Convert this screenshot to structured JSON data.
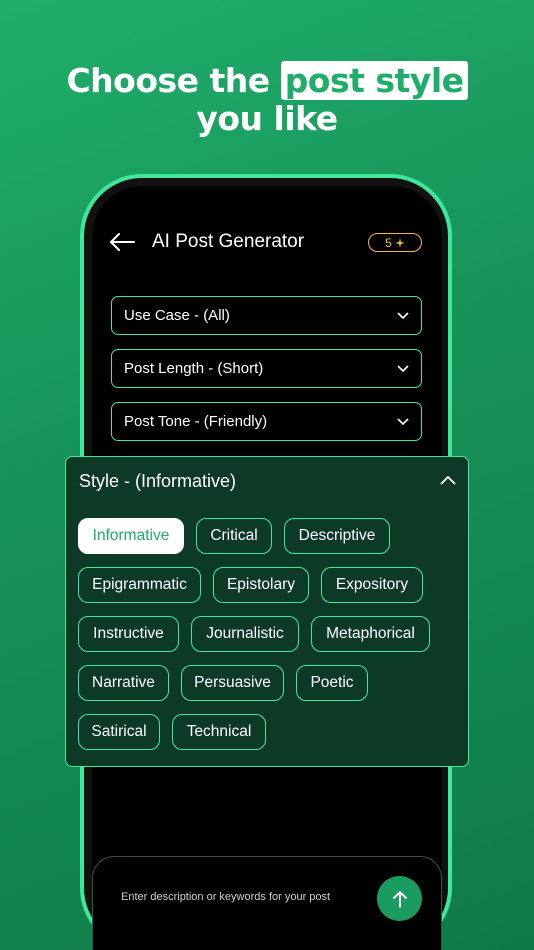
{
  "headline": {
    "line1_pre": "Choose the",
    "highlight": "post style",
    "line2": "you like"
  },
  "header": {
    "title": "AI Post Generator",
    "credits": "5"
  },
  "dropdowns": [
    {
      "label": "Use Case - (All)"
    },
    {
      "label": "Post Length - (Short)"
    },
    {
      "label": "Post Tone - (Friendly)"
    }
  ],
  "style_panel": {
    "title": "Style - (Informative)",
    "selected": "Informative",
    "chips": [
      "Informative",
      "Critical",
      "Descriptive",
      "Epigrammatic",
      "Epistolary",
      "Expository",
      "Instructive",
      "Journalistic",
      "Metaphorical",
      "Narrative",
      "Persuasive",
      "Poetic",
      "Satirical",
      "Technical"
    ]
  },
  "composer": {
    "placeholder": "Enter description or keywords for your post"
  },
  "colors": {
    "accent": "#3ee89a",
    "background": "#1fae6a",
    "credit": "#f5b82e",
    "panel": "#0d3a27"
  },
  "icons": {
    "back": "back-arrow-icon",
    "credits": "sparkle-icon",
    "dropdown": "chevron-down-icon",
    "collapse": "chevron-up-icon",
    "send": "arrow-up-icon"
  }
}
